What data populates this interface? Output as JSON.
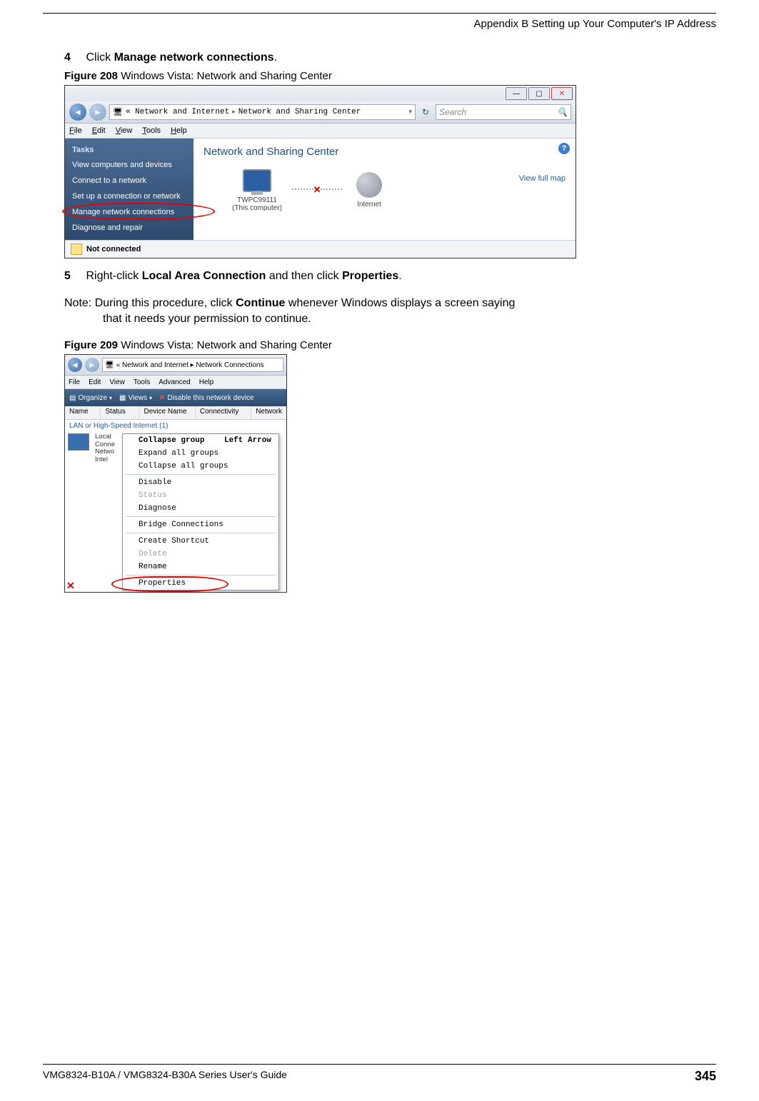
{
  "header": {
    "appendix": "Appendix B Setting up Your Computer's IP Address"
  },
  "steps": {
    "s4": {
      "num": "4",
      "prefix": "Click ",
      "bold": "Manage network connections",
      "suffix": "."
    },
    "s5": {
      "num": "5",
      "prefix": "Right-click ",
      "bold1": "Local Area Connection",
      "mid": " and then click ",
      "bold2": "Properties",
      "suffix": "."
    }
  },
  "note": {
    "label": "Note:",
    "line1a": " During this procedure, click ",
    "bold": "Continue",
    "line1b": " whenever Windows displays a screen saying",
    "line2": "that it needs your permission to continue."
  },
  "fig208": {
    "label": "Figure 208",
    "title": "   Windows Vista: Network and Sharing Center"
  },
  "fig209": {
    "label": "Figure 209",
    "title": "   Windows Vista: Network and Sharing Center"
  },
  "shot1": {
    "breadcrumb": {
      "pre": "«  Network and Internet  ",
      "arrow": "▸",
      "post": "  Network and Sharing Center"
    },
    "search_placeholder": "Search",
    "menus": {
      "file": "File",
      "edit": "Edit",
      "view": "View",
      "tools": "Tools",
      "help": "Help"
    },
    "tasks_title": "Tasks",
    "tasks": [
      "View computers and devices",
      "Connect to a network",
      "Set up a connection or network",
      "Manage network connections",
      "Diagnose and repair"
    ],
    "main_title": "Network and Sharing Center",
    "view_full_map": "View full map",
    "node1": {
      "name": "TWPC99111",
      "sub": "(This computer)"
    },
    "node2": "Internet",
    "status": "Not connected"
  },
  "shot2": {
    "breadcrumb": "«  Network and Internet  ▸ Network Connections",
    "menus": {
      "file": "File",
      "edit": "Edit",
      "view": "View",
      "tools": "Tools",
      "advanced": "Advanced",
      "help": "Help"
    },
    "toolbar": {
      "organize": "Organize",
      "views": "Views",
      "disable": "Disable this network device"
    },
    "columns": [
      "Name",
      "Status",
      "Device Name",
      "Connectivity",
      "Network"
    ],
    "group": "LAN or High-Speed Internet (1)",
    "lan_text": [
      "Local",
      "Conne",
      "Netwo",
      "Intel"
    ],
    "ctx": {
      "collapse": "Collapse group",
      "collapse_shortcut": "Left Arrow",
      "expand_all": "Expand all groups",
      "collapse_all": "Collapse all groups",
      "disable": "Disable",
      "status": "Status",
      "diagnose": "Diagnose",
      "bridge": "Bridge Connections",
      "shortcut": "Create Shortcut",
      "delete": "Delete",
      "rename": "Rename",
      "properties": "Properties"
    }
  },
  "footer": {
    "guide": "VMG8324-B10A / VMG8324-B30A Series User's Guide",
    "page": "345"
  }
}
